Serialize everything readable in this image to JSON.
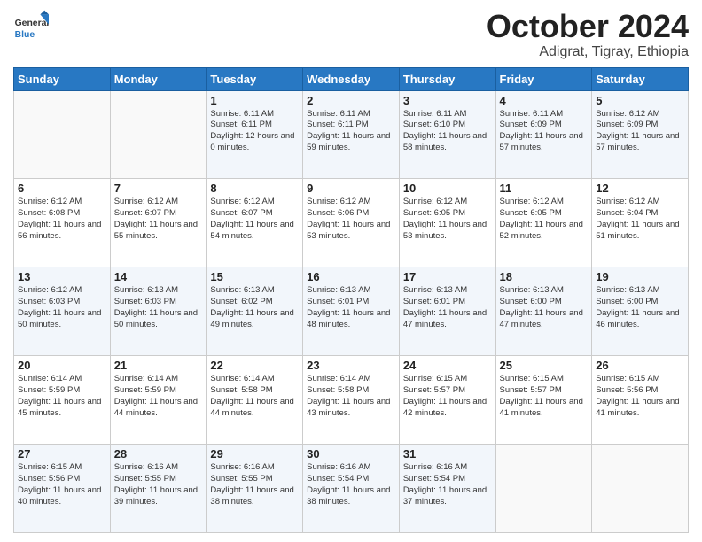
{
  "logo": {
    "general": "General",
    "blue": "Blue"
  },
  "header": {
    "month": "October 2024",
    "location": "Adigrat, Tigray, Ethiopia"
  },
  "weekdays": [
    "Sunday",
    "Monday",
    "Tuesday",
    "Wednesday",
    "Thursday",
    "Friday",
    "Saturday"
  ],
  "weeks": [
    [
      {
        "day": null
      },
      {
        "day": null
      },
      {
        "day": 1,
        "sunrise": "6:11 AM",
        "sunset": "6:11 PM",
        "daylight": "12 hours and 0 minutes."
      },
      {
        "day": 2,
        "sunrise": "6:11 AM",
        "sunset": "6:11 PM",
        "daylight": "11 hours and 59 minutes."
      },
      {
        "day": 3,
        "sunrise": "6:11 AM",
        "sunset": "6:10 PM",
        "daylight": "11 hours and 58 minutes."
      },
      {
        "day": 4,
        "sunrise": "6:11 AM",
        "sunset": "6:09 PM",
        "daylight": "11 hours and 57 minutes."
      },
      {
        "day": 5,
        "sunrise": "6:12 AM",
        "sunset": "6:09 PM",
        "daylight": "11 hours and 57 minutes."
      }
    ],
    [
      {
        "day": 6,
        "sunrise": "6:12 AM",
        "sunset": "6:08 PM",
        "daylight": "11 hours and 56 minutes."
      },
      {
        "day": 7,
        "sunrise": "6:12 AM",
        "sunset": "6:07 PM",
        "daylight": "11 hours and 55 minutes."
      },
      {
        "day": 8,
        "sunrise": "6:12 AM",
        "sunset": "6:07 PM",
        "daylight": "11 hours and 54 minutes."
      },
      {
        "day": 9,
        "sunrise": "6:12 AM",
        "sunset": "6:06 PM",
        "daylight": "11 hours and 53 minutes."
      },
      {
        "day": 10,
        "sunrise": "6:12 AM",
        "sunset": "6:05 PM",
        "daylight": "11 hours and 53 minutes."
      },
      {
        "day": 11,
        "sunrise": "6:12 AM",
        "sunset": "6:05 PM",
        "daylight": "11 hours and 52 minutes."
      },
      {
        "day": 12,
        "sunrise": "6:12 AM",
        "sunset": "6:04 PM",
        "daylight": "11 hours and 51 minutes."
      }
    ],
    [
      {
        "day": 13,
        "sunrise": "6:12 AM",
        "sunset": "6:03 PM",
        "daylight": "11 hours and 50 minutes."
      },
      {
        "day": 14,
        "sunrise": "6:13 AM",
        "sunset": "6:03 PM",
        "daylight": "11 hours and 50 minutes."
      },
      {
        "day": 15,
        "sunrise": "6:13 AM",
        "sunset": "6:02 PM",
        "daylight": "11 hours and 49 minutes."
      },
      {
        "day": 16,
        "sunrise": "6:13 AM",
        "sunset": "6:01 PM",
        "daylight": "11 hours and 48 minutes."
      },
      {
        "day": 17,
        "sunrise": "6:13 AM",
        "sunset": "6:01 PM",
        "daylight": "11 hours and 47 minutes."
      },
      {
        "day": 18,
        "sunrise": "6:13 AM",
        "sunset": "6:00 PM",
        "daylight": "11 hours and 47 minutes."
      },
      {
        "day": 19,
        "sunrise": "6:13 AM",
        "sunset": "6:00 PM",
        "daylight": "11 hours and 46 minutes."
      }
    ],
    [
      {
        "day": 20,
        "sunrise": "6:14 AM",
        "sunset": "5:59 PM",
        "daylight": "11 hours and 45 minutes."
      },
      {
        "day": 21,
        "sunrise": "6:14 AM",
        "sunset": "5:59 PM",
        "daylight": "11 hours and 44 minutes."
      },
      {
        "day": 22,
        "sunrise": "6:14 AM",
        "sunset": "5:58 PM",
        "daylight": "11 hours and 44 minutes."
      },
      {
        "day": 23,
        "sunrise": "6:14 AM",
        "sunset": "5:58 PM",
        "daylight": "11 hours and 43 minutes."
      },
      {
        "day": 24,
        "sunrise": "6:15 AM",
        "sunset": "5:57 PM",
        "daylight": "11 hours and 42 minutes."
      },
      {
        "day": 25,
        "sunrise": "6:15 AM",
        "sunset": "5:57 PM",
        "daylight": "11 hours and 41 minutes."
      },
      {
        "day": 26,
        "sunrise": "6:15 AM",
        "sunset": "5:56 PM",
        "daylight": "11 hours and 41 minutes."
      }
    ],
    [
      {
        "day": 27,
        "sunrise": "6:15 AM",
        "sunset": "5:56 PM",
        "daylight": "11 hours and 40 minutes."
      },
      {
        "day": 28,
        "sunrise": "6:16 AM",
        "sunset": "5:55 PM",
        "daylight": "11 hours and 39 minutes."
      },
      {
        "day": 29,
        "sunrise": "6:16 AM",
        "sunset": "5:55 PM",
        "daylight": "11 hours and 38 minutes."
      },
      {
        "day": 30,
        "sunrise": "6:16 AM",
        "sunset": "5:54 PM",
        "daylight": "11 hours and 38 minutes."
      },
      {
        "day": 31,
        "sunrise": "6:16 AM",
        "sunset": "5:54 PM",
        "daylight": "11 hours and 37 minutes."
      },
      {
        "day": null
      },
      {
        "day": null
      }
    ]
  ]
}
